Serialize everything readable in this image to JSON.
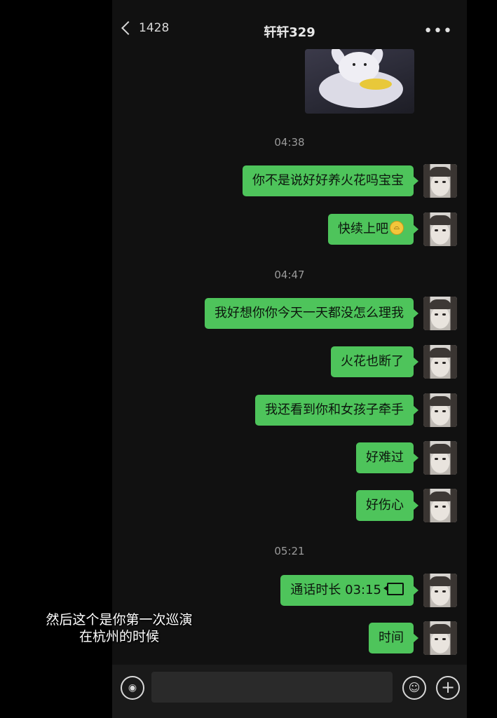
{
  "header": {
    "back_count": "1428",
    "title": "轩轩329",
    "more_label": "•••"
  },
  "timestamps": [
    "04:38",
    "04:47",
    "05:21"
  ],
  "messages": [
    {
      "text": "你不是说好好养火花吗宝宝"
    },
    {
      "text": "快续上吧"
    },
    {
      "text": "我好想你你今天一天都没怎么理我"
    },
    {
      "text": "火花也断了"
    },
    {
      "text": "我还看到你和女孩子牵手"
    },
    {
      "text": "好难过"
    },
    {
      "text": "好伤心"
    },
    {
      "text": "通话时长 03:15"
    },
    {
      "text": "时间"
    }
  ],
  "subtitle": {
    "line1": "然后这个是你第一次巡演",
    "line2": "在杭州的时候"
  },
  "input": {
    "value": "",
    "placeholder": ""
  },
  "icons": {
    "voice": "voice-icon",
    "emoji": "emoji-icon",
    "plus": "plus-icon",
    "call": "phone-call-icon",
    "sad_emoji": "sad-face-emoji"
  },
  "colors": {
    "bubble": "#4ec45b",
    "background": "#111111"
  }
}
